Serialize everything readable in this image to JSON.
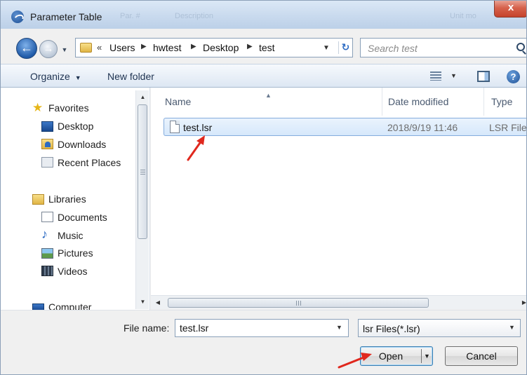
{
  "window": {
    "title": "Parameter Table",
    "background_ghost_text": [
      "Par. #",
      "Description",
      "Unit mo"
    ],
    "close_label": "x"
  },
  "address": {
    "prefix": "«",
    "breadcrumbs": [
      "Users",
      "hwtest",
      "Desktop",
      "test"
    ],
    "search_placeholder": "Search test"
  },
  "toolbar": {
    "organize_label": "Organize",
    "new_folder_label": "New folder"
  },
  "nav": {
    "favorites": {
      "label": "Favorites",
      "items": [
        "Desktop",
        "Downloads",
        "Recent Places"
      ]
    },
    "libraries": {
      "label": "Libraries",
      "items": [
        "Documents",
        "Music",
        "Pictures",
        "Videos"
      ]
    },
    "computer": {
      "label": "Computer"
    }
  },
  "file_list": {
    "columns": [
      "Name",
      "Date modified",
      "Type"
    ],
    "rows": [
      {
        "name": "test.lsr",
        "date_modified": "2018/9/19 11:46",
        "type": "LSR File",
        "selected": true
      }
    ]
  },
  "bottom": {
    "file_name_label": "File name:",
    "file_name_value": "test.lsr",
    "file_type_filter": "lsr Files(*.lsr)",
    "open_label": "Open",
    "cancel_label": "Cancel"
  },
  "colors": {
    "annotation_arrow": "#e0281e",
    "selection_fill": "#d6e8fb",
    "selection_border": "#84acdd"
  }
}
